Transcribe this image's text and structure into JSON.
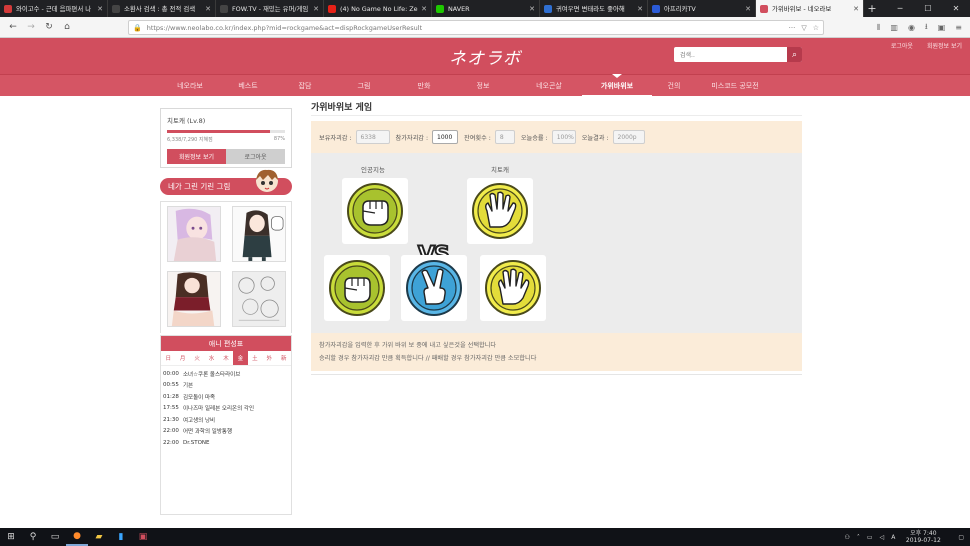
{
  "browser": {
    "tabs": [
      {
        "title": "와이고수 - 근데 음파편서 나",
        "favcolor": "#d33a3a",
        "active": false
      },
      {
        "title": "소환사 검색 : 총 전적 검색",
        "favcolor": "#444444",
        "active": false
      },
      {
        "title": "FOW.TV - 재밌는 유머/게임",
        "favcolor": "#444444",
        "active": false
      },
      {
        "title": "(4) No Game No Life: Ze",
        "favcolor": "#e62117",
        "active": false
      },
      {
        "title": "NAVER",
        "favcolor": "#1ec800",
        "active": false
      },
      {
        "title": "귀여우면 변태라도 좋아해",
        "favcolor": "#2f6fd1",
        "active": false
      },
      {
        "title": "아프리카TV",
        "favcolor": "#2b5bd7",
        "active": false
      },
      {
        "title": "가위바위보 - 네오라보",
        "favcolor": "#d14e5e",
        "active": true
      }
    ],
    "url": "https://www.neolabo.co.kr/index.php?mid=rockgame&act=dispRockgameUserResult"
  },
  "site": {
    "logo": "ネオラボ",
    "search_placeholder": "검색..",
    "header_links": [
      "로그아웃",
      "회원정보 보기"
    ],
    "menu": [
      {
        "label": "네오라보",
        "width": 60
      },
      {
        "label": "베스트",
        "width": 56
      },
      {
        "label": "잡담",
        "width": 58
      },
      {
        "label": "그림",
        "width": 60
      },
      {
        "label": "만화",
        "width": 60
      },
      {
        "label": "정보",
        "width": 58
      },
      {
        "label": "네오곤살",
        "width": 74
      },
      {
        "label": "가위바위보",
        "width": 62,
        "active": true
      },
      {
        "label": "건의",
        "width": 52
      },
      {
        "label": "미스코드 공모전",
        "width": 70
      }
    ]
  },
  "sidebar": {
    "user": "치토캐 (Lv.8)",
    "progress_text": "6,338/7,290 지혜점",
    "progress_percent": "87%",
    "progress_fraction": 0.87,
    "btn_profile": "회원정보 보기",
    "btn_logout": "로그아웃",
    "draw_banner": "네가 그린 기린 그림",
    "anime_title": "애니 편성표",
    "days": [
      "日",
      "月",
      "火",
      "水",
      "木",
      "金",
      "土",
      "外",
      "新"
    ],
    "selected_day": 5,
    "schedule": [
      {
        "time": "00:00",
        "title": "소녀☆쿠론 올스타라이브"
      },
      {
        "time": "00:55",
        "title": "기븐"
      },
      {
        "time": "01:28",
        "title": "김모돌이 마족"
      },
      {
        "time": "17:55",
        "title": "이나즈마 일레븐 오리온의 각인"
      },
      {
        "time": "21:30",
        "title": "여고생의 낭비"
      },
      {
        "time": "22:00",
        "title": "어떤 과학의 일방통행"
      },
      {
        "time": "22:00",
        "title": "Dr.STONE"
      }
    ]
  },
  "main": {
    "title": "가위바위보 게임",
    "fields": [
      {
        "label": "보유자괴감 :",
        "value": "6338",
        "width": 34,
        "white": false
      },
      {
        "label": "참가자괴감 :",
        "value": "1000",
        "width": 26,
        "white": true
      },
      {
        "label": "잔여횟수 :",
        "value": "8",
        "width": 20,
        "white": false
      },
      {
        "label": "오늘승률 :",
        "value": "100%",
        "width": 24,
        "white": false
      },
      {
        "label": "오늘결과 :",
        "value": "2000p",
        "width": 32,
        "white": false
      }
    ],
    "player_left": "인공지능",
    "player_right": "치토캐",
    "vs": "VS",
    "note_line1": "참가자괴감을 입력한 후 가위 바위 보 중에 내고 싶은것을 선택합니다",
    "note_line2": "승리할 경우 참가자괴감 만큼 획득합니다 // 패배할 경우 참가자괴감 만큼 소모합니다"
  },
  "taskbar": {
    "time": "오후 7:40",
    "date": "2019-07-12",
    "lang": "A"
  }
}
